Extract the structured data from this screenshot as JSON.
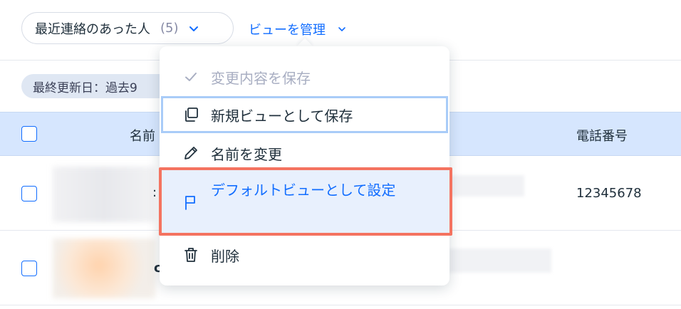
{
  "header": {
    "view_name": "最近連絡のあった人",
    "view_count": "(5)",
    "manage_views_label": "ビューを管理"
  },
  "filter_chip": "最終更新日：過去9",
  "table": {
    "columns": {
      "name": "名前",
      "phone": "電話番号"
    },
    "rows": [
      {
        "name_partial": ":",
        "email_partial": "°",
        "phone": "12345678"
      },
      {
        "name_partial": "c",
        "email_partial": "2",
        "phone": ""
      }
    ]
  },
  "menu": {
    "items": [
      {
        "id": "save",
        "label": "変更内容を保存",
        "icon": "check-icon",
        "disabled": true
      },
      {
        "id": "save_as_new",
        "label": "新規ビューとして保存",
        "icon": "copy-icon"
      },
      {
        "id": "rename",
        "label": "名前を変更",
        "icon": "pencil-icon"
      },
      {
        "id": "set_default",
        "label": "デフォルトビューとして設定",
        "icon": "flag-icon"
      },
      {
        "id": "delete",
        "label": "削除",
        "icon": "trash-icon"
      }
    ]
  },
  "colors": {
    "accent": "#116dff",
    "header_bg": "#d6e6fe",
    "highlight_border": "#f47360",
    "disabled_text": "#a8aec2"
  }
}
